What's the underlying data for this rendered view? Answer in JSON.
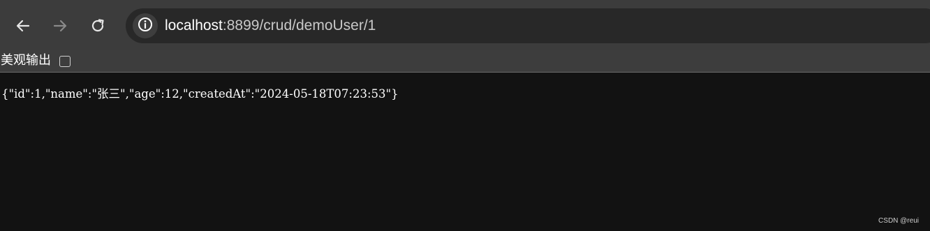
{
  "browser": {
    "url_host": "localhost",
    "url_rest": ":8899/crud/demoUser/1",
    "icons": {
      "back": "back-arrow-icon",
      "forward": "forward-arrow-icon",
      "reload": "reload-icon",
      "site_info": "info-icon"
    },
    "forward_enabled": false
  },
  "pretty_print": {
    "label": "美观输出",
    "checked": false
  },
  "page": {
    "json_text": "{\"id\":1,\"name\":\"张三\",\"age\":12,\"createdAt\":\"2024-05-18T07:23:53\"}"
  },
  "watermark": {
    "text": "CSDN @reui"
  },
  "colors": {
    "toolbar_bg": "#3c3c3c",
    "omnibox_bg": "#282828",
    "page_bg": "#121212",
    "text": "#ffffff"
  }
}
